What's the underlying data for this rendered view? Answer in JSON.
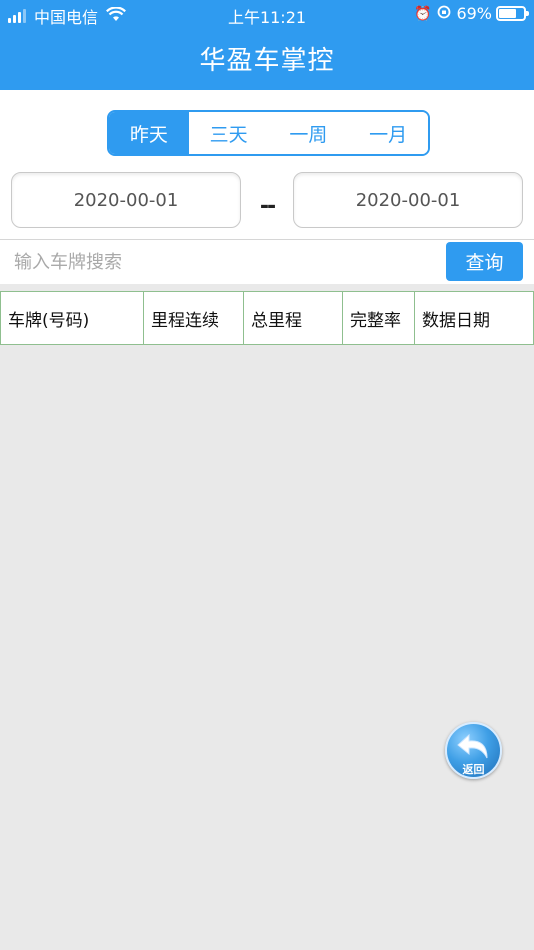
{
  "status_bar": {
    "carrier": "中国电信",
    "time": "上午11:21",
    "battery": "69%",
    "battery_level": 0.69
  },
  "header": {
    "title": "华盈车掌控"
  },
  "range_tabs": [
    {
      "label": "昨天",
      "active": true
    },
    {
      "label": "三天",
      "active": false
    },
    {
      "label": "一周",
      "active": false
    },
    {
      "label": "一月",
      "active": false
    }
  ],
  "date_range": {
    "start": "2020-00-01",
    "separator": "--",
    "end": "2020-00-01"
  },
  "search": {
    "placeholder": "输入车牌搜索",
    "button_label": "查询"
  },
  "table": {
    "columns": [
      "车牌(号码)",
      "里程连续",
      "总里程",
      "完整率",
      "数据日期"
    ],
    "rows": []
  },
  "back_button": {
    "label": "返回"
  },
  "colors": {
    "accent": "#2f9bf0",
    "background": "#e9e9e9",
    "table_border": "#8fbf8f"
  },
  "icons": [
    "signal-icon",
    "wifi-icon",
    "alarm-icon",
    "rotation-lock-icon",
    "battery-icon",
    "back-arrow-icon"
  ]
}
